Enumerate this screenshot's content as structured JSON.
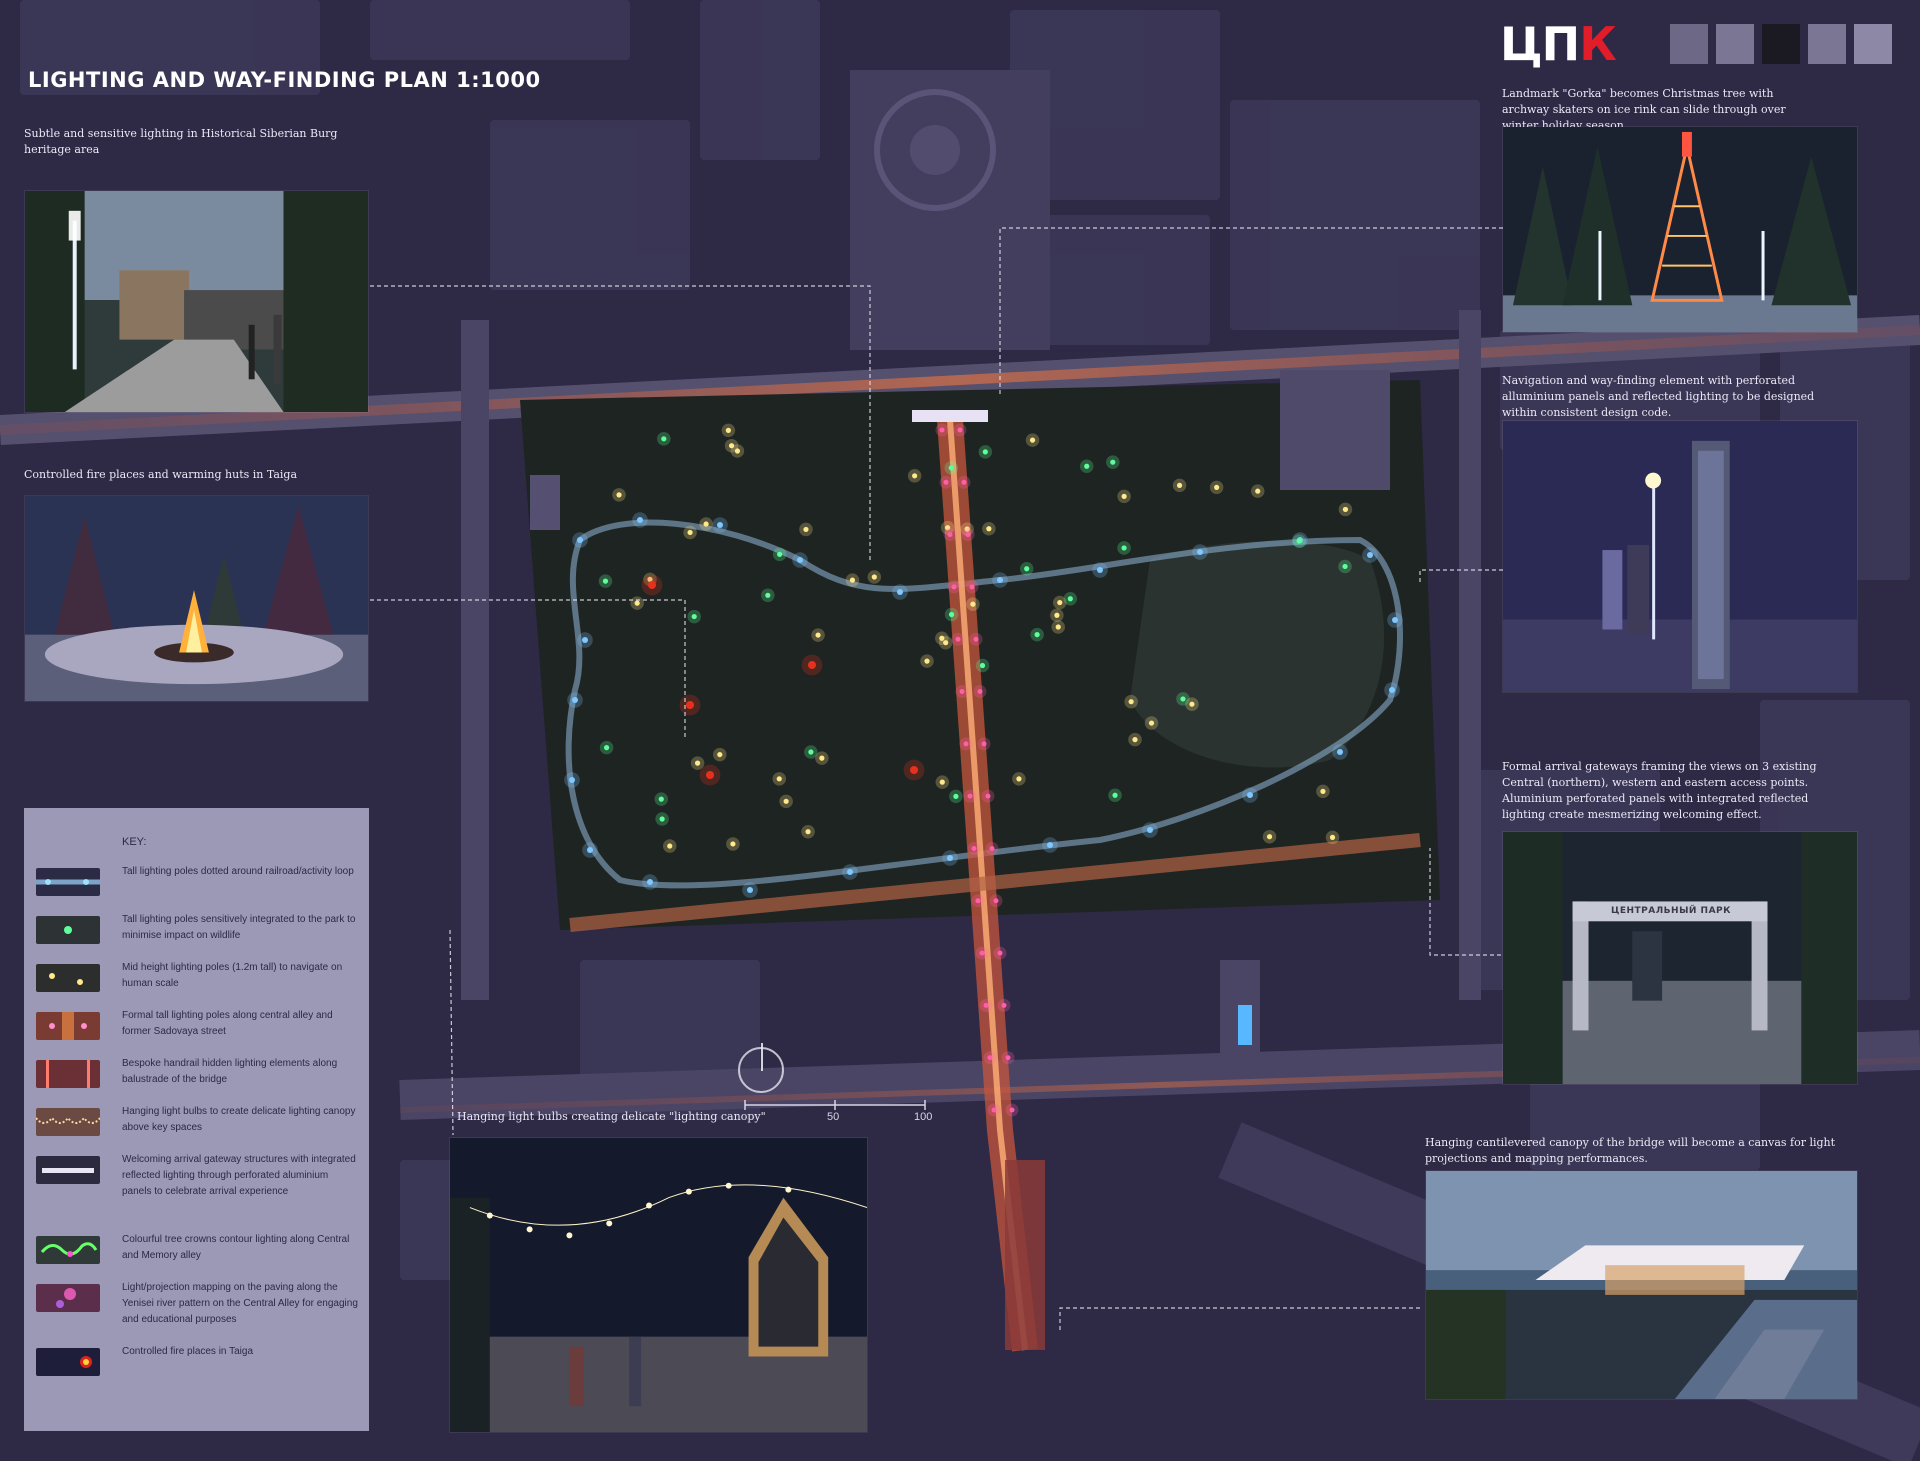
{
  "title": "LIGHTING AND WAY-FINDING PLAN 1:1000",
  "logo": {
    "white_part": "ЦП",
    "red_part": "К",
    "swatches": [
      "#6d6885",
      "#7b7694",
      "#1b1a22",
      "#7b7694",
      "#8c88a5"
    ]
  },
  "captions": {
    "heritage": "Subtle and sensitive lighting in Historical Siberian Burg heritage area",
    "fire": "Controlled fire places and warming huts in Taiga",
    "gorka": "Landmark \"Gorka\" becomes Christmas tree with archway skaters on ice rink can slide through over winter holiday season",
    "navigation": "Navigation and way-finding element with perforated alluminium panels and reflected lighting to be designed within consistent design code.",
    "gateway": "Formal arrival gateways framing the views on 3 existing Central (northern), western and eastern access points. Aluminium perforated panels with integrated reflected lighting create mesmerizing welcoming effect.",
    "canopy_bulbs": "Hanging light bulbs creating delicate \"lighting canopy\"",
    "bridge": "Hanging cantilevered canopy of the bridge will become a canvas for light projections and mapping performances."
  },
  "gateway_sign": "ЦЕНТРАЛЬНЫЙ ПАРК",
  "key": {
    "title": "KEY:",
    "items": [
      {
        "text": "Tall lighting poles dotted around railroad/activity loop",
        "icon": "blue-pole-icon"
      },
      {
        "text": "Tall lighting poles sensitively integrated to the park to minimise impact on wildlife",
        "icon": "green-pole-icon"
      },
      {
        "text": "Mid height lighting poles (1.2m tall) to navigate on human scale",
        "icon": "yellow-pole-icon"
      },
      {
        "text": "Formal tall lighting poles along central alley and former Sadovaya street",
        "icon": "pink-pole-icon"
      },
      {
        "text": "Bespoke handrail hidden lighting elements along balustrade of the bridge",
        "icon": "handrail-icon"
      },
      {
        "text": "Hanging light bulbs to create delicate lighting canopy above key spaces",
        "icon": "bulb-icon"
      },
      {
        "text": "Welcoming arrival gateway structures with integrated reflected lighting through perforated aluminium panels to celebrate arrival experience",
        "icon": "gateway-icon"
      },
      {
        "text": "Colourful tree crowns contour lighting along Central and Memory alley",
        "icon": "tree-crown-icon"
      },
      {
        "text": "Light/projection mapping on the paving along the Yenisei river pattern on the Central Alley for engaging and educational purposes",
        "icon": "projection-icon"
      },
      {
        "text": "Controlled fire places in Taiga",
        "icon": "fire-icon"
      }
    ]
  },
  "scale_labels": [
    "50",
    "100"
  ],
  "colors": {
    "background": "#2e2945",
    "blue_light": "#7ec8ff",
    "green_light": "#5dff9a",
    "yellow_light": "#ffe98a",
    "pink_light": "#ff5ea8",
    "fire": "#e8311d"
  }
}
